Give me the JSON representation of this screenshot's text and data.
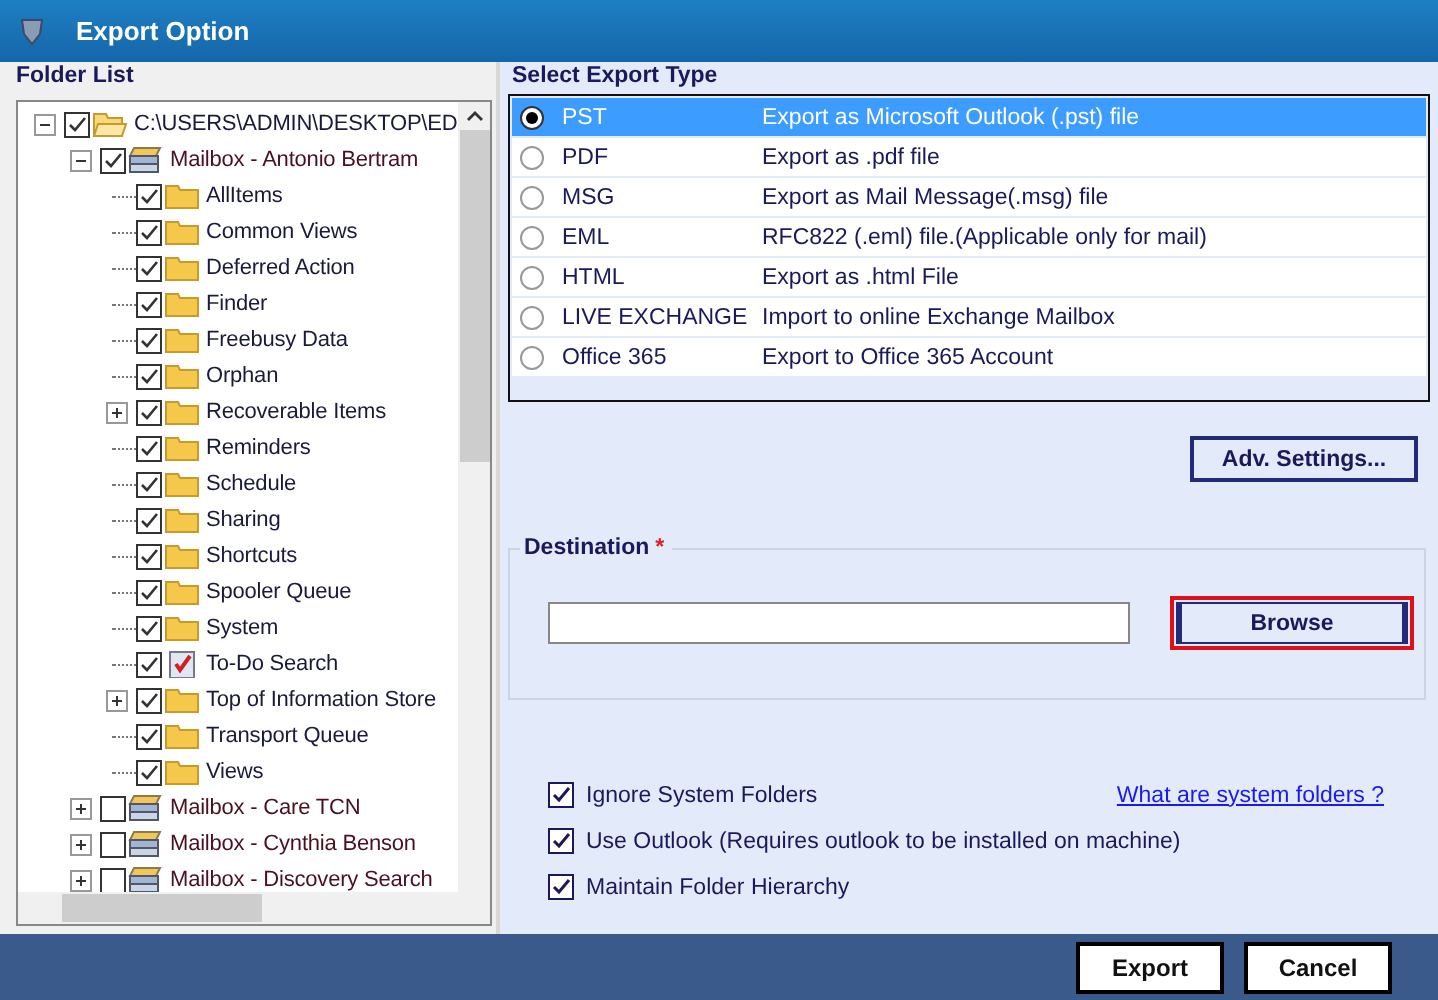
{
  "window": {
    "title": "Export Option"
  },
  "folder_list": {
    "title": "Folder List",
    "tree": [
      {
        "label": "C:\\USERS\\ADMIN\\DESKTOP\\ED",
        "kind": "drive",
        "checked": true,
        "expanded": true,
        "children": [
          {
            "label": "Mailbox - Antonio Bertram",
            "kind": "mailbox",
            "checked": true,
            "expanded": true,
            "children": [
              {
                "label": "AllItems",
                "kind": "folder",
                "checked": true
              },
              {
                "label": "Common Views",
                "kind": "folder",
                "checked": true
              },
              {
                "label": "Deferred Action",
                "kind": "folder",
                "checked": true
              },
              {
                "label": "Finder",
                "kind": "folder",
                "checked": true
              },
              {
                "label": "Freebusy Data",
                "kind": "folder",
                "checked": true
              },
              {
                "label": "Orphan",
                "kind": "folder",
                "checked": true
              },
              {
                "label": "Recoverable Items",
                "kind": "folder",
                "checked": true,
                "expanded": false
              },
              {
                "label": "Reminders",
                "kind": "folder",
                "checked": true
              },
              {
                "label": "Schedule",
                "kind": "folder",
                "checked": true
              },
              {
                "label": "Sharing",
                "kind": "folder",
                "checked": true
              },
              {
                "label": "Shortcuts",
                "kind": "folder",
                "checked": true
              },
              {
                "label": "Spooler Queue",
                "kind": "folder",
                "checked": true
              },
              {
                "label": "System",
                "kind": "folder",
                "checked": true
              },
              {
                "label": "To-Do Search",
                "kind": "task",
                "checked": true
              },
              {
                "label": "Top of Information Store",
                "kind": "folder",
                "checked": true,
                "expanded": false
              },
              {
                "label": "Transport Queue",
                "kind": "folder",
                "checked": true
              },
              {
                "label": "Views",
                "kind": "folder",
                "checked": true
              }
            ]
          },
          {
            "label": "Mailbox - Care TCN",
            "kind": "mailbox",
            "checked": false,
            "expanded": false
          },
          {
            "label": "Mailbox - Cynthia Benson",
            "kind": "mailbox",
            "checked": false,
            "expanded": false
          },
          {
            "label": "Mailbox - Discovery Search",
            "kind": "mailbox",
            "checked": false,
            "expanded": false
          }
        ]
      }
    ]
  },
  "export_type": {
    "title": "Select Export Type",
    "options": [
      {
        "format": "PST",
        "description": "Export as Microsoft Outlook (.pst) file",
        "selected": true
      },
      {
        "format": "PDF",
        "description": "Export as .pdf file",
        "selected": false
      },
      {
        "format": "MSG",
        "description": "Export as Mail Message(.msg) file",
        "selected": false
      },
      {
        "format": "EML",
        "description": "RFC822 (.eml) file.(Applicable only for mail)",
        "selected": false
      },
      {
        "format": "HTML",
        "description": "Export as .html File",
        "selected": false
      },
      {
        "format": "LIVE EXCHANGE",
        "description": "Import to online Exchange Mailbox",
        "selected": false
      },
      {
        "format": "Office 365",
        "description": "Export to Office 365 Account",
        "selected": false
      }
    ]
  },
  "adv_settings_button": "Adv. Settings...",
  "destination": {
    "label": "Destination",
    "required_mark": "*",
    "browse_button": "Browse"
  },
  "options": [
    {
      "label": "Ignore System Folders",
      "checked": true
    },
    {
      "label": "Use Outlook (Requires outlook to be installed on machine)",
      "checked": true
    },
    {
      "label": "Maintain Folder Hierarchy",
      "checked": true
    }
  ],
  "help_link": "What are system folders ?",
  "buttons": [
    "Export",
    "Cancel"
  ]
}
